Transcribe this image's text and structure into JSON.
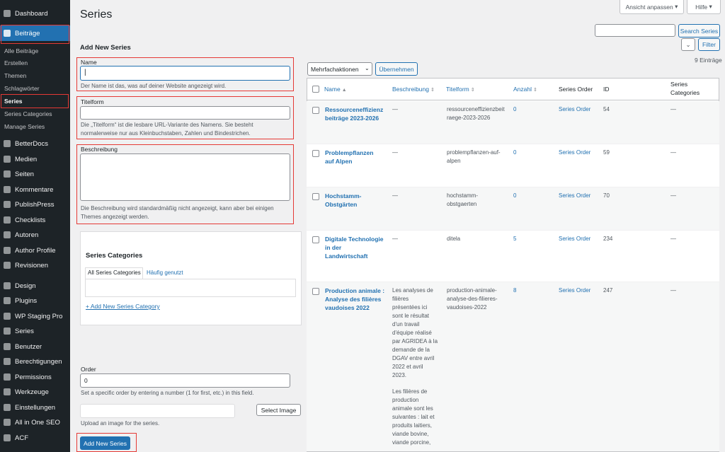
{
  "menu": {
    "dashboard": "Dashboard",
    "beitraege": "Beiträge",
    "sub": [
      "Alle Beiträge",
      "Erstellen",
      "Themen",
      "Schlagwörter",
      "Series",
      "Series Categories",
      "Manage Series"
    ],
    "items": [
      "BetterDocs",
      "Medien",
      "Seiten",
      "Kommentare",
      "PublishPress",
      "Checklists",
      "Autoren",
      "Author Profile",
      "Revisionen",
      "Design",
      "Plugins",
      "WP Staging Pro",
      "Series",
      "Benutzer",
      "Berechtigungen",
      "Permissions",
      "Werkzeuge",
      "Einstellungen",
      "All in One SEO",
      "ACF"
    ]
  },
  "header": {
    "title": "Series",
    "screen_options": "Ansicht anpassen",
    "help": "Hilfe"
  },
  "search": {
    "button": "Search Series",
    "placeholder": ""
  },
  "filter": {
    "button": "Filter"
  },
  "form": {
    "heading": "Add New Series",
    "name_label": "Name",
    "name_help": "Der Name ist das, was auf deiner Website angezeigt wird.",
    "slug_label": "Titelform",
    "slug_help_1": "Die „Titelform“ ist die lesbare URL-Variante des Namens. Sie besteht",
    "slug_help_2": "normalerweise nur aus Kleinbuchstaben, Zahlen und Bindestrichen.",
    "desc_label": "Beschreibung",
    "desc_help_1": "Die Beschreibung wird standardmäßig nicht angezeigt, kann aber bei einigen",
    "desc_help_2": "Themes angezeigt werden.",
    "cat_title": "Series Categories",
    "cat_tab_all": "All Series Categories",
    "cat_tab_popular": "Häufig genutzt",
    "cat_add": "+ Add New Series Category",
    "order_label": "Order",
    "order_value": "0",
    "order_help": "Set a specific order by entering a number (1 for first, etc.) in this field.",
    "image_button": "Select Image",
    "image_help": "Upload an image for the series.",
    "submit": "Add New Series"
  },
  "table": {
    "bulk_select": "Mehrfachaktionen",
    "apply": "Übernehmen",
    "count": "9 Einträge",
    "columns": [
      "Name",
      "Beschreibung",
      "Titelform",
      "Anzahl",
      "Series Order",
      "ID",
      "Series",
      "Categories"
    ],
    "rows": [
      {
        "name1": "Ressourceneffizienz",
        "name2": "beiträge 2023-2026",
        "name3": "",
        "desc": "—",
        "slug1": "ressourceneffizienzbeit",
        "slug2": "raege-2023-2026",
        "slug3": "",
        "count": "0",
        "order": "Series Order",
        "id": "54",
        "cats": "—"
      },
      {
        "name1": "Problempflanzen",
        "name2": "auf Alpen",
        "name3": "",
        "desc": "—",
        "slug1": "problempflanzen-auf-",
        "slug2": "alpen",
        "slug3": "",
        "count": "0",
        "order": "Series Order",
        "id": "59",
        "cats": "—"
      },
      {
        "name1": "Hochstamm-",
        "name2": "Obstgärten",
        "name3": "",
        "desc": "—",
        "slug1": "hochstamm-",
        "slug2": "obstgaerten",
        "slug3": "",
        "count": "0",
        "order": "Series Order",
        "id": "70",
        "cats": "—"
      },
      {
        "name1": "Digitale Technologie",
        "name2": "in der",
        "name3": "Landwirtschaft",
        "desc": "—",
        "slug1": "ditela",
        "slug2": "",
        "slug3": "",
        "count": "5",
        "order": "Series Order",
        "id": "234",
        "cats": "—"
      },
      {
        "name1": "Production animale :",
        "name2": "Analyse des filières",
        "name3": "vaudoises 2022",
        "desc": "",
        "slug1": "production-animale-",
        "slug2": "analyse-des-filieres-",
        "slug3": "vaudoises-2022",
        "count": "8",
        "order": "Series Order",
        "id": "247",
        "cats": "—"
      }
    ],
    "desc5_p1": [
      "Les analyses de",
      "filières",
      "présentées ici",
      "sont le résultat",
      "d'un travail",
      "d'équipe réalisé",
      "par AGRIDEA à la",
      "demande de la",
      "DGAV entre avril",
      "2022 et avril",
      "2023."
    ],
    "desc5_p2": [
      "Les filières de",
      "production",
      "animale sont les",
      "suivantes : lait et",
      "produits laitiers,",
      "viande bovine,",
      "viande porcine,"
    ]
  },
  "colors": {
    "sidebar": "#1d2327",
    "accent": "#2271b1",
    "highlight": "#e53935"
  }
}
